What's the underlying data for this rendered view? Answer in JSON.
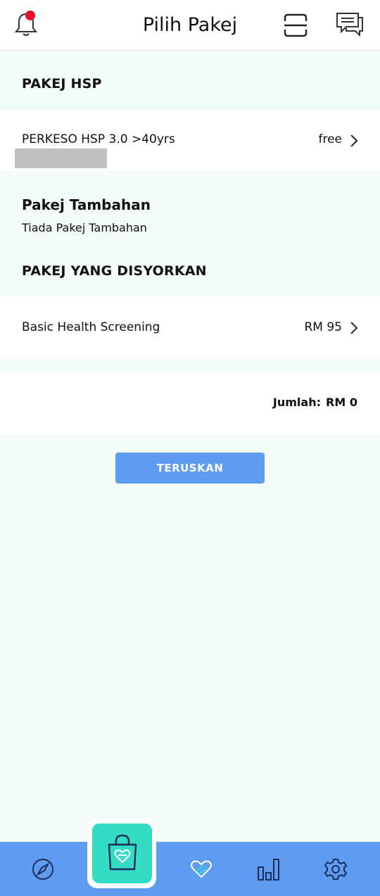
{
  "header": {
    "title": "Pilih Pakej",
    "icons": [
      "bell-icon",
      "scan-icon",
      "chat-icon"
    ],
    "notification_dot_color": "#e8112d"
  },
  "sections": {
    "hsp_heading": "PAKEJ HSP",
    "hsp_item": {
      "label": "PERKESO HSP 3.0 >40yrs",
      "price": "free"
    },
    "tambahan_heading": "Pakej Tambahan",
    "tambahan_text": "Tiada Pakej Tambahan",
    "disyorkan_heading": "PAKEJ YANG DISYORKAN",
    "disyorkan_item": {
      "label": "Basic Health Screening",
      "price": "RM 95"
    }
  },
  "total": {
    "label": "Jumlah:",
    "value": "RM 0"
  },
  "button": {
    "label": "TERUSKAN"
  },
  "colors": {
    "accent": "#5e9cf2",
    "center_tab": "#35dcc4",
    "background": "#f3fcf7"
  },
  "bottom_nav": {
    "items": [
      "compass-icon",
      "shopping-bag-icon",
      "heart-stethoscope-icon",
      "chart-icon",
      "settings-icon"
    ],
    "active": "shopping-bag-icon"
  }
}
